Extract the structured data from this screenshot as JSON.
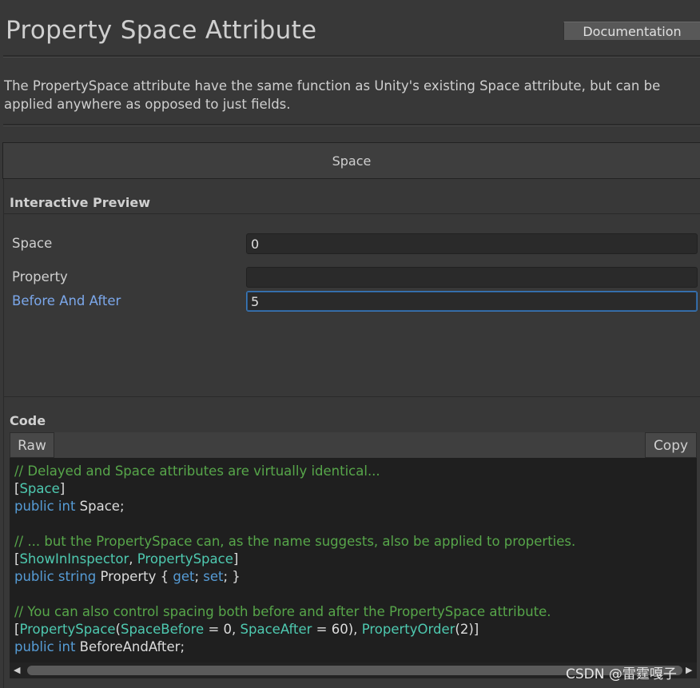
{
  "header": {
    "title": "Property Space Attribute",
    "documentation_label": "Documentation"
  },
  "description": "The PropertySpace attribute have the same function as Unity's existing Space attribute, but can be applied anywhere as opposed to just fields.",
  "tab": {
    "label": "Space"
  },
  "preview": {
    "heading": "Interactive Preview",
    "fields": [
      {
        "label": "Space",
        "value": "0"
      },
      {
        "label": "Property",
        "value": ""
      },
      {
        "label": "Before And After",
        "value": "5"
      }
    ]
  },
  "code": {
    "heading": "Code",
    "raw_label": "Raw",
    "copy_label": "Copy",
    "lines": [
      [
        {
          "t": "// Delayed and Space attributes are virtually identical...",
          "c": "comment"
        }
      ],
      [
        {
          "t": "[",
          "c": "plain"
        },
        {
          "t": "Space",
          "c": "type"
        },
        {
          "t": "]",
          "c": "plain"
        }
      ],
      [
        {
          "t": "public",
          "c": "kw"
        },
        {
          "t": " ",
          "c": "plain"
        },
        {
          "t": "int",
          "c": "kw"
        },
        {
          "t": " Space;",
          "c": "plain"
        }
      ],
      [],
      [
        {
          "t": "// ... but the PropertySpace can, as the name suggests, also be applied to properties.",
          "c": "comment"
        }
      ],
      [
        {
          "t": "[",
          "c": "plain"
        },
        {
          "t": "ShowInInspector",
          "c": "type"
        },
        {
          "t": ", ",
          "c": "plain"
        },
        {
          "t": "PropertySpace",
          "c": "type"
        },
        {
          "t": "]",
          "c": "plain"
        }
      ],
      [
        {
          "t": "public",
          "c": "kw"
        },
        {
          "t": " ",
          "c": "plain"
        },
        {
          "t": "string",
          "c": "kw"
        },
        {
          "t": " Property { ",
          "c": "plain"
        },
        {
          "t": "get",
          "c": "kw"
        },
        {
          "t": "; ",
          "c": "plain"
        },
        {
          "t": "set",
          "c": "kw"
        },
        {
          "t": "; }",
          "c": "plain"
        }
      ],
      [],
      [
        {
          "t": "// You can also control spacing both before and after the PropertySpace attribute.",
          "c": "comment"
        }
      ],
      [
        {
          "t": "[",
          "c": "plain"
        },
        {
          "t": "PropertySpace",
          "c": "type"
        },
        {
          "t": "(",
          "c": "plain"
        },
        {
          "t": "SpaceBefore",
          "c": "type"
        },
        {
          "t": " = 0, ",
          "c": "plain"
        },
        {
          "t": "SpaceAfter",
          "c": "type"
        },
        {
          "t": " = 60), ",
          "c": "plain"
        },
        {
          "t": "PropertyOrder",
          "c": "type"
        },
        {
          "t": "(2)]",
          "c": "plain"
        }
      ],
      [
        {
          "t": "public",
          "c": "kw"
        },
        {
          "t": " ",
          "c": "plain"
        },
        {
          "t": "int",
          "c": "kw"
        },
        {
          "t": " BeforeAndAfter;",
          "c": "plain"
        }
      ]
    ]
  },
  "watermark": "CSDN @雷霆嘎子",
  "colors": {
    "comment": "#57a64a",
    "type": "#4ec9b0",
    "keyword": "#569cd6",
    "active_label": "#7ba7ea",
    "focus_border": "#3a79bb"
  }
}
